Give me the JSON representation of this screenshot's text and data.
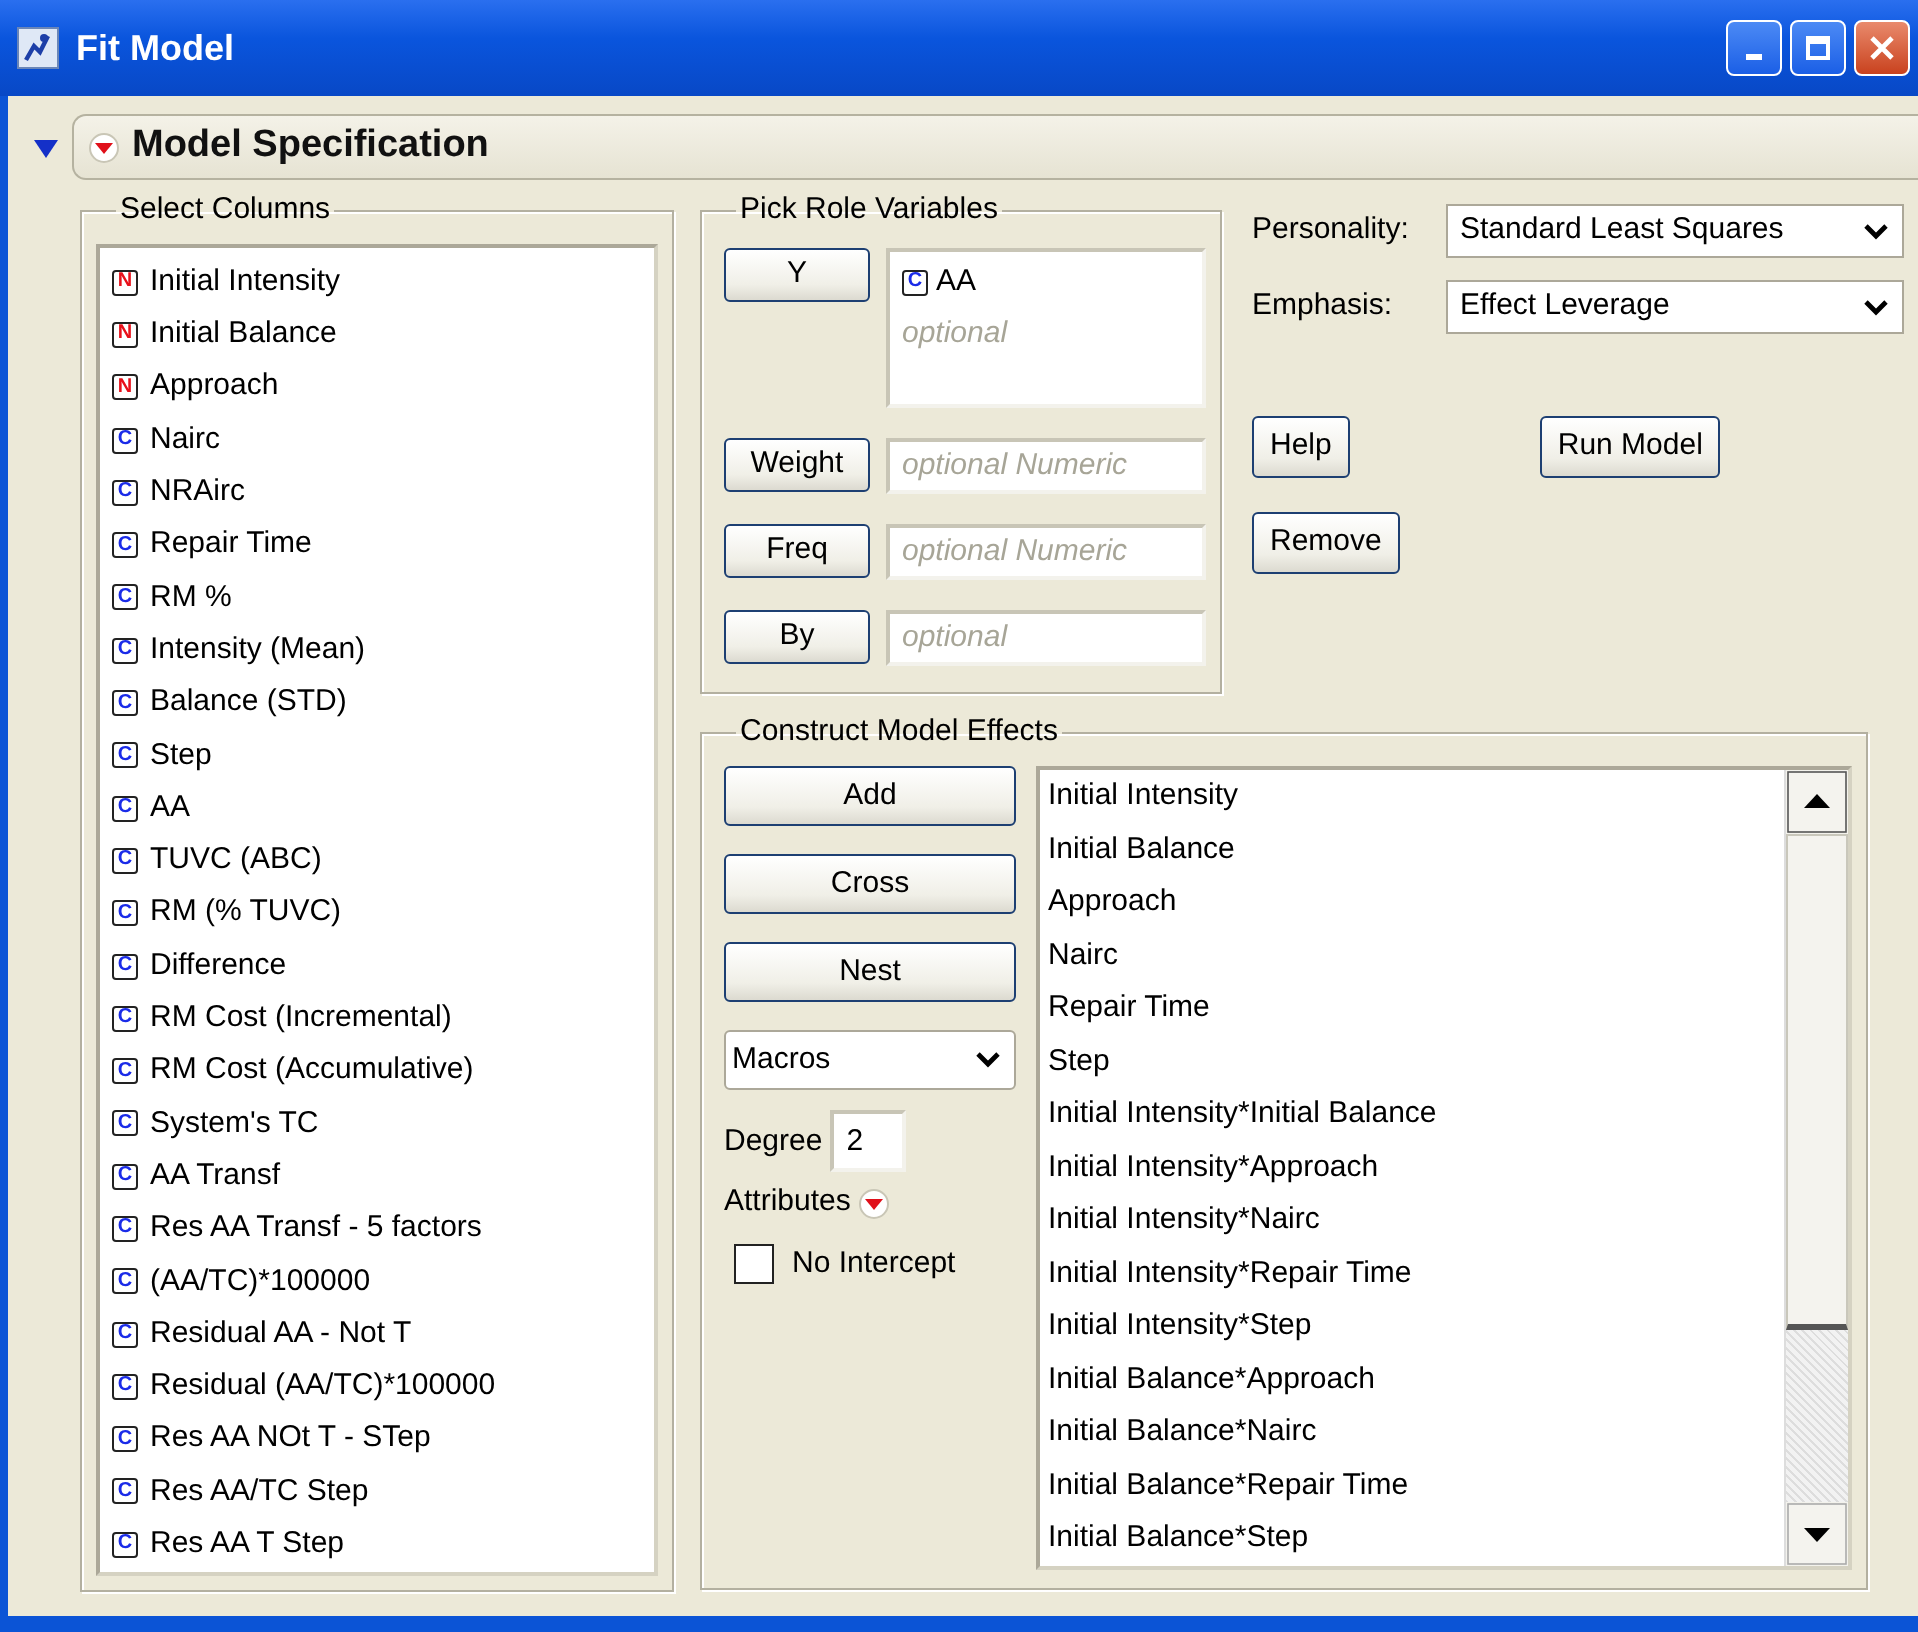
{
  "window": {
    "title": "Fit Model"
  },
  "outline": {
    "title": "Model Specification",
    "expanded": true
  },
  "select_columns": {
    "title": "Select Columns",
    "columns": [
      {
        "badge": "N",
        "kind": "nominal",
        "name": "Initial Intensity"
      },
      {
        "badge": "N",
        "kind": "nominal",
        "name": "Initial Balance"
      },
      {
        "badge": "N",
        "kind": "nominal",
        "name": "Approach"
      },
      {
        "badge": "C",
        "kind": "continuous",
        "name": "Nairc"
      },
      {
        "badge": "C",
        "kind": "continuous",
        "name": "NRAirc"
      },
      {
        "badge": "C",
        "kind": "continuous",
        "name": "Repair Time"
      },
      {
        "badge": "C",
        "kind": "continuous",
        "name": "RM %"
      },
      {
        "badge": "C",
        "kind": "continuous",
        "name": "Intensity (Mean)"
      },
      {
        "badge": "C",
        "kind": "continuous",
        "name": "Balance (STD)"
      },
      {
        "badge": "C",
        "kind": "continuous",
        "name": "Step"
      },
      {
        "badge": "C",
        "kind": "continuous",
        "name": "AA"
      },
      {
        "badge": "C",
        "kind": "continuous",
        "name": "TUVC (ABC)"
      },
      {
        "badge": "C",
        "kind": "continuous",
        "name": "RM (% TUVC)"
      },
      {
        "badge": "C",
        "kind": "continuous",
        "name": "Difference"
      },
      {
        "badge": "C",
        "kind": "continuous",
        "name": "RM Cost (Incremental)"
      },
      {
        "badge": "C",
        "kind": "continuous",
        "name": "RM Cost (Accumulative)"
      },
      {
        "badge": "C",
        "kind": "continuous",
        "name": "System's TC"
      },
      {
        "badge": "C",
        "kind": "continuous",
        "name": "AA Transf"
      },
      {
        "badge": "C",
        "kind": "continuous",
        "name": "Res AA Transf - 5 factors"
      },
      {
        "badge": "C",
        "kind": "continuous",
        "name": "(AA/TC)*100000"
      },
      {
        "badge": "C",
        "kind": "continuous",
        "name": "Residual AA - Not T"
      },
      {
        "badge": "C",
        "kind": "continuous",
        "name": "Residual (AA/TC)*100000"
      },
      {
        "badge": "C",
        "kind": "continuous",
        "name": "Res AA NOt T - STep"
      },
      {
        "badge": "C",
        "kind": "continuous",
        "name": "Res AA/TC Step"
      },
      {
        "badge": "C",
        "kind": "continuous",
        "name": "Res AA T Step"
      }
    ]
  },
  "pick_roles": {
    "title": "Pick Role Variables",
    "roles": [
      {
        "button": "Y",
        "items": [
          {
            "badge": "C",
            "kind": "continuous",
            "name": "AA"
          }
        ],
        "placeholder": "optional"
      },
      {
        "button": "Weight",
        "placeholder": "optional Numeric"
      },
      {
        "button": "Freq",
        "placeholder": "optional Numeric"
      },
      {
        "button": "By",
        "placeholder": "optional"
      }
    ]
  },
  "personality": {
    "label": "Personality:",
    "value": "Standard Least Squares"
  },
  "emphasis": {
    "label": "Emphasis:",
    "value": "Effect Leverage"
  },
  "action_buttons": [
    "Help",
    "Run Model",
    "Remove"
  ],
  "construct_effects": {
    "title": "Construct Model Effects",
    "buttons": [
      "Add",
      "Cross",
      "Nest"
    ],
    "macros": "Macros",
    "degree": {
      "label": "Degree",
      "value": "2"
    },
    "attributes": "Attributes",
    "no_intercept": {
      "label": "No Intercept",
      "checked": false
    },
    "effects": [
      "Initial Intensity",
      "Initial Balance",
      "Approach",
      "Nairc",
      "Repair Time",
      "Step",
      "Initial Intensity*Initial Balance",
      "Initial Intensity*Approach",
      "Initial Intensity*Nairc",
      "Initial Intensity*Repair Time",
      "Initial Intensity*Step",
      "Initial Balance*Approach",
      "Initial Balance*Nairc",
      "Initial Balance*Repair Time",
      "Initial Balance*Step"
    ]
  }
}
